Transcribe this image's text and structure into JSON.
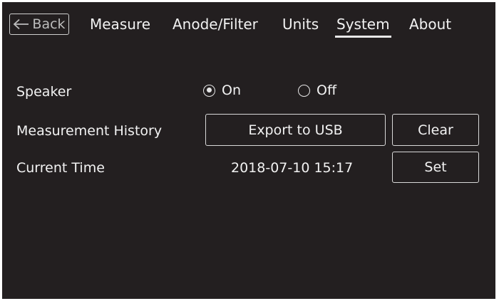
{
  "nav": {
    "back_label": "Back",
    "tabs": [
      {
        "label": "Measure"
      },
      {
        "label": "Anode/Filter"
      },
      {
        "label": "Units"
      },
      {
        "label": "System",
        "selected": true
      },
      {
        "label": "About"
      }
    ]
  },
  "settings": {
    "speaker": {
      "label": "Speaker",
      "options": [
        {
          "label": "On",
          "selected": true
        },
        {
          "label": "Off",
          "selected": false
        }
      ]
    },
    "history": {
      "label": "Measurement History",
      "export_button": "Export to USB",
      "clear_button": "Clear"
    },
    "time": {
      "label": "Current Time",
      "value": "2018-07-10 15:17",
      "set_button": "Set"
    }
  },
  "colors": {
    "background": "#231f20",
    "foreground": "#f2f2f2",
    "border": "#d9d9d9"
  }
}
